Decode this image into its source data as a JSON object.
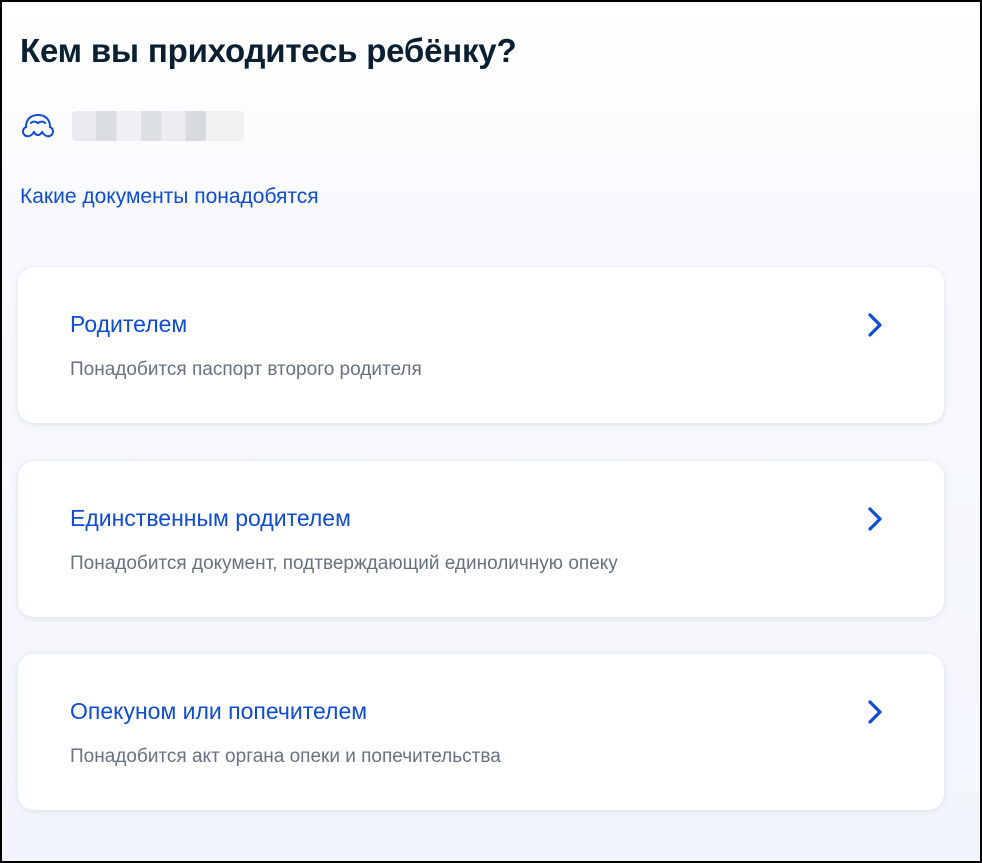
{
  "page": {
    "title": "Кем вы приходитесь ребёнку?"
  },
  "child": {
    "icon": "child-face-icon",
    "name_display": "blurred"
  },
  "links": {
    "documents_needed": "Какие документы понадобятся"
  },
  "options": [
    {
      "title": "Родителем",
      "subtitle": "Понадобится паспорт второго родителя"
    },
    {
      "title": "Единственным родителем",
      "subtitle": "Понадобится документ, подтверждающий единоличную опеку"
    },
    {
      "title": "Опекуном или попечителем",
      "subtitle": "Понадобится акт органа опеки и попечительства"
    }
  ],
  "colors": {
    "accent": "#0d4cd3",
    "title": "#0b1f33",
    "subtitle": "#66727f",
    "background": "#f2f5fb",
    "card": "#ffffff"
  },
  "icons": {
    "chevron": "chevron-right-icon"
  }
}
